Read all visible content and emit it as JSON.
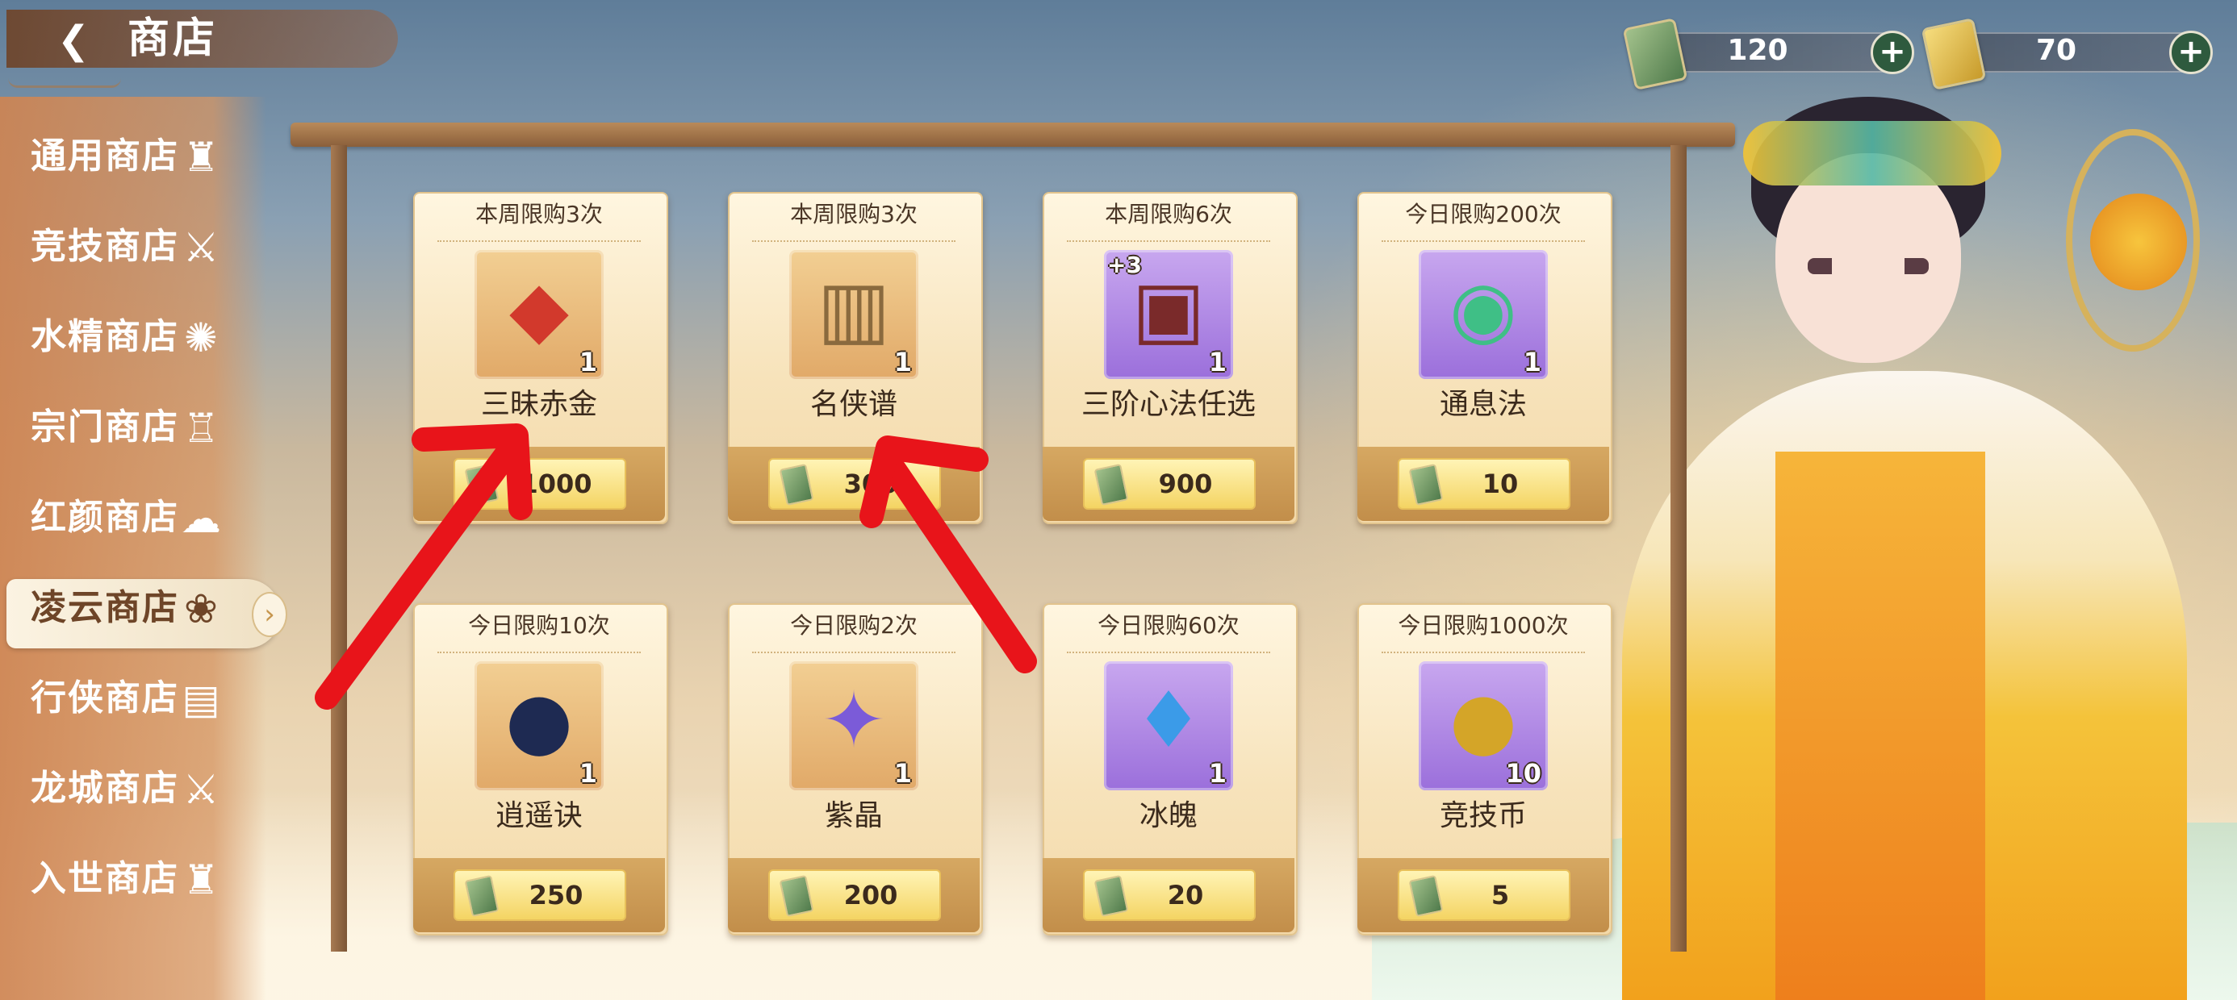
{
  "header": {
    "title": "商店",
    "back_icon": "back-arrow-icon"
  },
  "currencies": [
    {
      "icon": "ticket-icon",
      "value": "120",
      "plus": "+"
    },
    {
      "icon": "gold-token-icon",
      "value": "70",
      "plus": "+"
    }
  ],
  "sidebar": {
    "items": [
      {
        "label": "通用商店",
        "icon": "helmet-icon",
        "glyph": "♜",
        "active": false
      },
      {
        "label": "竞技商店",
        "icon": "crossed-swords-icon",
        "glyph": "⚔",
        "active": false
      },
      {
        "label": "水精商店",
        "icon": "swirl-icon",
        "glyph": "✺",
        "active": false
      },
      {
        "label": "宗门商店",
        "icon": "statue-icon",
        "glyph": "♖",
        "active": false
      },
      {
        "label": "红颜商店",
        "icon": "cloud-icon",
        "glyph": "☁",
        "active": false
      },
      {
        "label": "凌云商店",
        "icon": "lotus-icon",
        "glyph": "❀",
        "active": true
      },
      {
        "label": "行侠商店",
        "icon": "scroll-icon",
        "glyph": "▤",
        "active": false
      },
      {
        "label": "龙城商店",
        "icon": "crossed-swords-icon",
        "glyph": "⚔",
        "active": false
      },
      {
        "label": "入世商店",
        "icon": "helmet-icon",
        "glyph": "♜",
        "active": false
      }
    ],
    "active_arrow": "›"
  },
  "shop": {
    "items": [
      {
        "limit": "本周限购3次",
        "name": "三昧赤金",
        "count": "1",
        "price": "1000",
        "bg": "gold",
        "glyph": "◆",
        "glyph_color": "#d2392c",
        "icon": "red-gem-icon",
        "plus": ""
      },
      {
        "limit": "本周限购3次",
        "name": "名侠谱",
        "count": "1",
        "price": "300",
        "bg": "gold",
        "glyph": "▥",
        "glyph_color": "#8a6a3e",
        "icon": "scroll-book-icon",
        "plus": ""
      },
      {
        "limit": "本周限购6次",
        "name": "三阶心法任选",
        "count": "1",
        "price": "900",
        "bg": "purple",
        "glyph": "▣",
        "glyph_color": "#7a2a2a",
        "icon": "treasure-box-icon",
        "plus": "+3"
      },
      {
        "limit": "今日限购200次",
        "name": "通息法",
        "count": "1",
        "price": "10",
        "bg": "purple",
        "glyph": "◉",
        "glyph_color": "#3fbf86",
        "icon": "green-orb-icon",
        "plus": ""
      },
      {
        "limit": "今日限购10次",
        "name": "逍遥诀",
        "count": "1",
        "price": "250",
        "bg": "gold",
        "glyph": "●",
        "glyph_color": "#1e2a52",
        "icon": "dark-orb-book-icon",
        "plus": ""
      },
      {
        "limit": "今日限购2次",
        "name": "紫晶",
        "count": "1",
        "price": "200",
        "bg": "gold",
        "glyph": "✦",
        "glyph_color": "#7b5bd8",
        "icon": "purple-crystal-icon",
        "plus": ""
      },
      {
        "limit": "今日限购60次",
        "name": "冰魄",
        "count": "1",
        "price": "20",
        "bg": "purple",
        "glyph": "♦",
        "glyph_color": "#3b9be8",
        "icon": "blue-crystal-icon",
        "plus": ""
      },
      {
        "limit": "今日限购1000次",
        "name": "竞技币",
        "count": "10",
        "price": "5",
        "bg": "purple",
        "glyph": "●",
        "glyph_color": "#d4a528",
        "icon": "gold-coin-icon",
        "plus": ""
      }
    ]
  },
  "colors": {
    "annotation_arrow": "#e8141a",
    "accent": "#c28e4a"
  }
}
